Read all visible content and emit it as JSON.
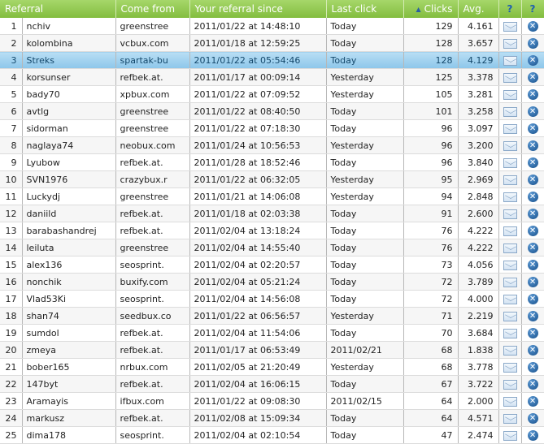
{
  "header": {
    "referral": "Referral",
    "come_from": "Come from",
    "since": "Your referral since",
    "last_click": "Last click",
    "clicks": "Clicks",
    "avg": "Avg.",
    "help1": "?",
    "help2": "?"
  },
  "rows": [
    {
      "idx": "1",
      "name": "nchiv",
      "from": "greenstree",
      "since": "2011/01/22 at 14:48:10",
      "last": "Today",
      "clicks": "129",
      "avg": "4.161"
    },
    {
      "idx": "2",
      "name": "kolombina",
      "from": "vcbux.com",
      "since": "2011/01/18 at 12:59:25",
      "last": "Today",
      "clicks": "128",
      "avg": "3.657"
    },
    {
      "idx": "3",
      "name": "Streks",
      "from": "spartak-bu",
      "since": "2011/01/22 at 05:54:46",
      "last": "Today",
      "clicks": "128",
      "avg": "4.129"
    },
    {
      "idx": "4",
      "name": "korsunser",
      "from": "refbek.at.",
      "since": "2011/01/17 at 00:09:14",
      "last": "Yesterday",
      "clicks": "125",
      "avg": "3.378"
    },
    {
      "idx": "5",
      "name": "bady70",
      "from": "xpbux.com",
      "since": "2011/01/22 at 07:09:52",
      "last": "Yesterday",
      "clicks": "105",
      "avg": "3.281"
    },
    {
      "idx": "6",
      "name": "avtlg",
      "from": "greenstree",
      "since": "2011/01/22 at 08:40:50",
      "last": "Today",
      "clicks": "101",
      "avg": "3.258"
    },
    {
      "idx": "7",
      "name": "sidorman",
      "from": "greenstree",
      "since": "2011/01/22 at 07:18:30",
      "last": "Today",
      "clicks": "96",
      "avg": "3.097"
    },
    {
      "idx": "8",
      "name": "naglaya74",
      "from": "neobux.com",
      "since": "2011/01/24 at 10:56:53",
      "last": "Yesterday",
      "clicks": "96",
      "avg": "3.200"
    },
    {
      "idx": "9",
      "name": "Lyubow",
      "from": "refbek.at.",
      "since": "2011/01/28 at 18:52:46",
      "last": "Today",
      "clicks": "96",
      "avg": "3.840"
    },
    {
      "idx": "10",
      "name": "SVN1976",
      "from": "crazybux.r",
      "since": "2011/01/22 at 06:32:05",
      "last": "Yesterday",
      "clicks": "95",
      "avg": "2.969"
    },
    {
      "idx": "11",
      "name": "Luckydj",
      "from": "greenstree",
      "since": "2011/01/21 at 14:06:08",
      "last": "Yesterday",
      "clicks": "94",
      "avg": "2.848"
    },
    {
      "idx": "12",
      "name": "daniild",
      "from": "refbek.at.",
      "since": "2011/01/18 at 02:03:38",
      "last": "Today",
      "clicks": "91",
      "avg": "2.600"
    },
    {
      "idx": "13",
      "name": "barabashandrej",
      "from": "refbek.at.",
      "since": "2011/02/04 at 13:18:24",
      "last": "Today",
      "clicks": "76",
      "avg": "4.222"
    },
    {
      "idx": "14",
      "name": "leiluta",
      "from": "greenstree",
      "since": "2011/02/04 at 14:55:40",
      "last": "Today",
      "clicks": "76",
      "avg": "4.222"
    },
    {
      "idx": "15",
      "name": "alex136",
      "from": "seosprint.",
      "since": "2011/02/04 at 02:20:57",
      "last": "Today",
      "clicks": "73",
      "avg": "4.056"
    },
    {
      "idx": "16",
      "name": "nonchik",
      "from": "buxify.com",
      "since": "2011/02/04 at 05:21:24",
      "last": "Today",
      "clicks": "72",
      "avg": "3.789"
    },
    {
      "idx": "17",
      "name": "Vlad53Ki",
      "from": "seosprint.",
      "since": "2011/02/04 at 14:56:08",
      "last": "Today",
      "clicks": "72",
      "avg": "4.000"
    },
    {
      "idx": "18",
      "name": "shan74",
      "from": "seedbux.co",
      "since": "2011/01/22 at 06:56:57",
      "last": "Yesterday",
      "clicks": "71",
      "avg": "2.219"
    },
    {
      "idx": "19",
      "name": "sumdol",
      "from": "refbek.at.",
      "since": "2011/02/04 at 11:54:06",
      "last": "Today",
      "clicks": "70",
      "avg": "3.684"
    },
    {
      "idx": "20",
      "name": "zmeya",
      "from": "refbek.at.",
      "since": "2011/01/17 at 06:53:49",
      "last": "2011/02/21",
      "clicks": "68",
      "avg": "1.838"
    },
    {
      "idx": "21",
      "name": "bober165",
      "from": "nrbux.com",
      "since": "2011/02/05 at 21:20:49",
      "last": "Yesterday",
      "clicks": "68",
      "avg": "3.778"
    },
    {
      "idx": "22",
      "name": "147byt",
      "from": "refbek.at.",
      "since": "2011/02/04 at 16:06:15",
      "last": "Today",
      "clicks": "67",
      "avg": "3.722"
    },
    {
      "idx": "23",
      "name": "Aramayis",
      "from": "ifbux.com",
      "since": "2011/01/22 at 09:08:30",
      "last": "2011/02/15",
      "clicks": "64",
      "avg": "2.000"
    },
    {
      "idx": "24",
      "name": "markusz",
      "from": "refbek.at.",
      "since": "2011/02/08 at 15:09:34",
      "last": "Today",
      "clicks": "64",
      "avg": "4.571"
    },
    {
      "idx": "25",
      "name": "dima178",
      "from": "seosprint.",
      "since": "2011/02/04 at 02:10:54",
      "last": "Today",
      "clicks": "47",
      "avg": "2.474"
    }
  ],
  "selected_row": "3",
  "icons": {
    "message": "mail-icon",
    "remove": "close-icon"
  },
  "colors": {
    "header": "#8cc44a",
    "selected": "#a9d6f1",
    "icon_blue": "#1f5fb0"
  }
}
